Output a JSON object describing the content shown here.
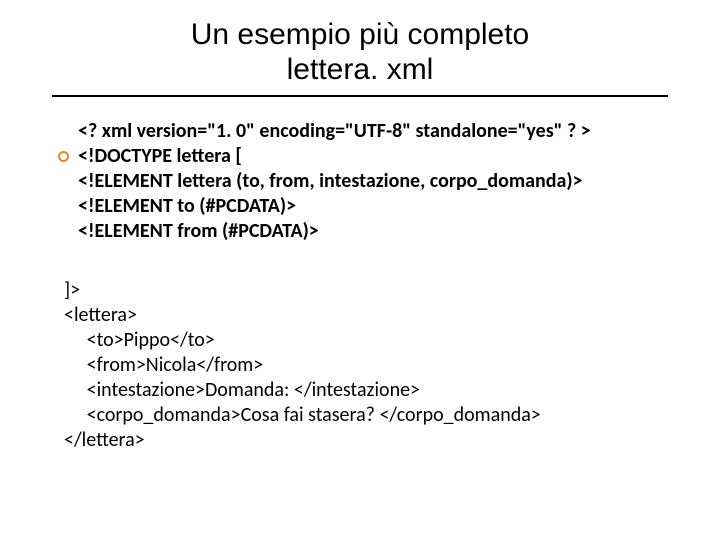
{
  "title": {
    "line1": "Un esempio più completo",
    "line2": "lettera. xml"
  },
  "block1": {
    "l1": "<? xml version=\"1. 0\" encoding=\"UTF-8\" standalone=\"yes\" ? >",
    "l2": "<!DOCTYPE lettera [",
    "l3": "<!ELEMENT lettera (to, from, intestazione, corpo_domanda)>",
    "l4": "<!ELEMENT to (#PCDATA)>",
    "l5": "<!ELEMENT from (#PCDATA)>"
  },
  "block2": {
    "l1": "]>",
    "l2": "<lettera>",
    "l3": "     <to>Pippo</to>",
    "l4": "     <from>Nicola</from>",
    "l5": "     <intestazione>Domanda: </intestazione>",
    "l6": "     <corpo_domanda>Cosa fai stasera? </corpo_domanda>",
    "l7": "</lettera>"
  }
}
